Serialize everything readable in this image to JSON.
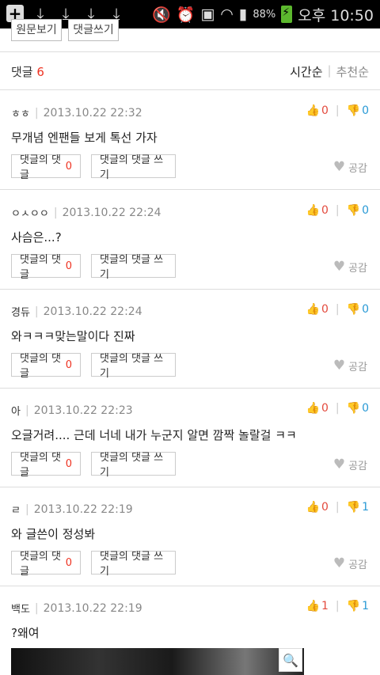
{
  "status_bar": {
    "battery": "88%",
    "time": "오후 10:50",
    "icons": [
      "plus-icon",
      "download-icon",
      "download-icon",
      "download-icon",
      "download-icon",
      "mute-icon",
      "alarm-icon",
      "screenshot-icon",
      "wifi-icon",
      "signal-icon",
      "battery-icon"
    ]
  },
  "top_buttons": {
    "left_label": "원문보기",
    "right_label": "댓글쓰기"
  },
  "comments_header": {
    "title": "댓글",
    "count": "6",
    "sort_time": "시간순",
    "sort_separator": "|",
    "sort_recommend": "추천순"
  },
  "comment_labels": {
    "reply_count": "댓글의 댓글",
    "write_reply": "댓글의 댓글 쓰기",
    "like": "공감",
    "separator": "|"
  },
  "comments": [
    {
      "author": "ㅎㅎ",
      "date": "2013.10.22 22:32",
      "up": "0",
      "down": "0",
      "text": "무개념 엔팬들 보게 톡선 가자",
      "replies": "0"
    },
    {
      "author": "ㅇㅅㅇㅇ",
      "date": "2013.10.22 22:24",
      "up": "0",
      "down": "0",
      "text": "사슴은...?",
      "replies": "0"
    },
    {
      "author": "경듀",
      "date": "2013.10.22 22:24",
      "up": "0",
      "down": "0",
      "text": "와ㅋㅋㅋ맞는말이다 진짜",
      "replies": "0"
    },
    {
      "author": "아",
      "date": "2013.10.22 22:23",
      "up": "0",
      "down": "0",
      "text": "오글거려.... 근데 너네 내가 누군지 알면 깜짝 놀랄걸 ㅋㅋ",
      "replies": "0"
    },
    {
      "author": "ㄹ",
      "date": "2013.10.22 22:19",
      "up": "0",
      "down": "1",
      "text": "와 글쓴이 정성봐",
      "replies": "0"
    }
  ],
  "last_comment": {
    "author": "백도",
    "date": "2013.10.22 22:19",
    "up": "1",
    "down": "1",
    "text": "?왜여"
  }
}
